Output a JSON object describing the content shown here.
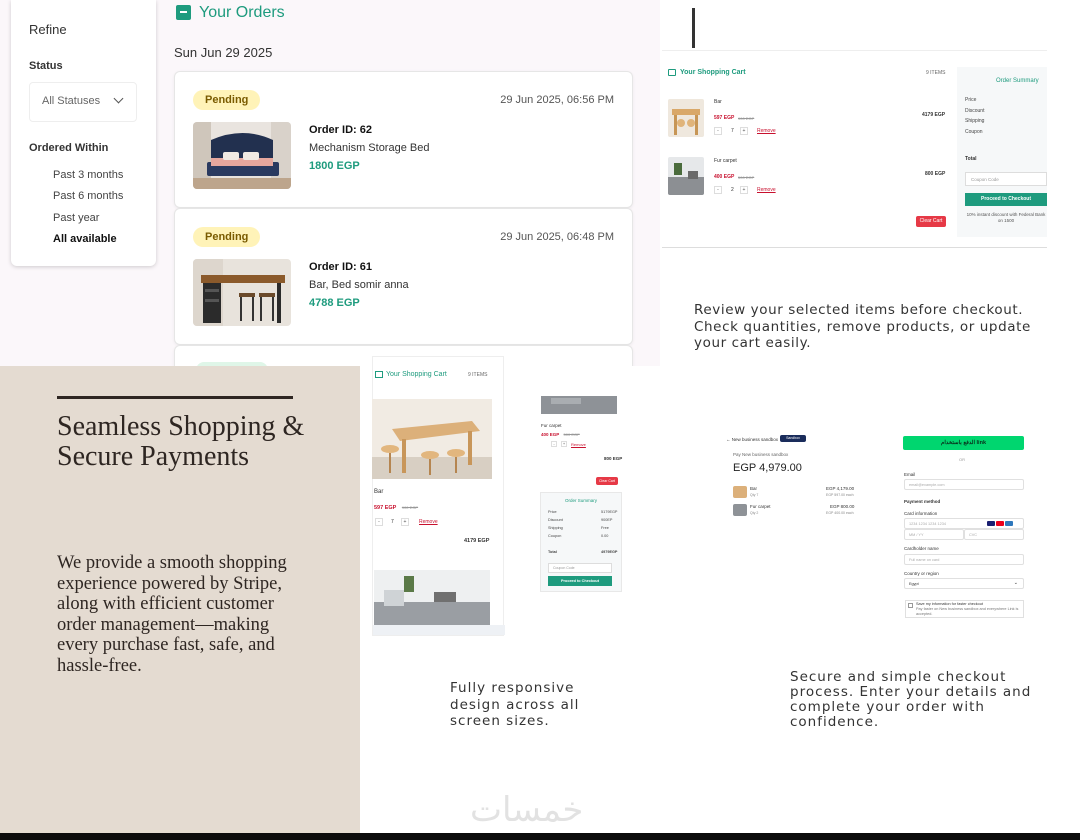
{
  "orders": {
    "heading": "Your Orders",
    "date": "Sun Jun 29 2025",
    "refine": {
      "title": "Refine",
      "status_label": "Status",
      "status_value": "All Statuses",
      "ordered_within_label": "Ordered Within",
      "ranges": [
        "Past 3 months",
        "Past 6 months",
        "Past year",
        "All available"
      ],
      "selected_range": "All available"
    },
    "cards": [
      {
        "status": "Pending",
        "datetime": "29 Jun 2025, 06:56 PM",
        "order_id": "Order ID: 62",
        "product": "Mechanism Storage Bed",
        "price": "1800 EGP"
      },
      {
        "status": "Pending",
        "datetime": "29 Jun 2025, 06:48 PM",
        "order_id": "Order ID: 61",
        "product": "Bar, Bed somir anna",
        "price": "4788 EGP"
      }
    ]
  },
  "cart_desktop": {
    "title": "Your Shopping Cart",
    "count": "9 ITEMS",
    "items": [
      {
        "name": "Bar",
        "price": "597 EGP",
        "old_price": "900 EGP",
        "qty": "7",
        "remove": "Remove",
        "total": "4179 EGP"
      },
      {
        "name": "Fur carpet",
        "price": "400 EGP",
        "old_price": "500 EGP",
        "qty": "2",
        "remove": "Remove",
        "total": "800 EGP"
      }
    ],
    "clear_cart": "Clear Cart",
    "summary": {
      "heading": "Order Summary",
      "labels": [
        "Price",
        "Discount",
        "Shipping",
        "Coupon"
      ],
      "total_label": "Total",
      "coupon_placeholder": "Coupon Code",
      "checkout_button": "Proceed to Checkout",
      "note": "10% instant discount with Federal Bank on 1500"
    },
    "caption": "Review your selected items before checkout. Check quantities, remove products, or update your cart easily."
  },
  "promo": {
    "title": "Seamless Shopping & Secure Payments",
    "body": "We provide a smooth shopping experience powered by Stripe, along with efficient customer order management—making every purchase fast, safe, and hassle-free."
  },
  "cart_mobile": {
    "title": "Your Shopping Cart",
    "count": "9 ITEMS",
    "item_name": "Bar",
    "item_price": "597 EGP",
    "item_old_price": "900 EGP",
    "item_qty": "7",
    "item_remove": "Remove",
    "item_total": "4179 EGP",
    "second_name": "Fur carpet",
    "second_price": "400 EGP",
    "second_old_price": "500 EGP",
    "second_remove": "Remove",
    "second_total": "800 EGP",
    "clear_cart": "Clear Cart",
    "summary_heading": "Order Summary",
    "summary_rows": [
      {
        "label": "Price",
        "value": "5179EGP"
      },
      {
        "label": "Discount",
        "value": "900EP"
      },
      {
        "label": "Shipping",
        "value": "Free"
      },
      {
        "label": "Coupon",
        "value": "0.00"
      }
    ],
    "total_label": "Total",
    "total_value": "4979EGP",
    "coupon_placeholder": "Coupon Code",
    "checkout_button": "Proceed to Checkout",
    "caption": "Fully responsive design across all screen sizes."
  },
  "checkout": {
    "business": "New business sandbox",
    "sandbox_badge": "Sandbox",
    "pay_to": "Pay New business sandbox",
    "amount": "EGP 4,979.00",
    "items": [
      {
        "name": "Bar",
        "qty": "Qty 7",
        "price": "EGP 4,179.00",
        "unit": "EGP 597.00 each"
      },
      {
        "name": "Fur carpet",
        "qty": "Qty 2",
        "price": "EGP 800.00",
        "unit": "EGP 400.00 each"
      }
    ],
    "link_button": "الدفع باستخدام link",
    "or": "OR",
    "email_label": "Email",
    "email_placeholder": "email@example.com",
    "payment_method": "Payment method",
    "card_info": "Card information",
    "card_number": "1234 1234 1234 1234",
    "card_expiry": "MM / YY",
    "card_cvc": "CVC",
    "cardholder_label": "Cardholder name",
    "cardholder_placeholder": "Full name on card",
    "country_label": "Country or region",
    "country_value": "Egypt",
    "save_info": "Save my information for faster checkout",
    "save_info_sub": "Pay faster on New business sandbox and everywhere Link is accepted.",
    "caption": "Secure and simple checkout process. Enter your details and complete your order with confidence."
  },
  "watermark": "خمسات",
  "colors": {
    "accent": "#1e9b7e",
    "promo_bg": "#e4dbd1",
    "pending_bg": "#fff3b8",
    "danger": "#e63946",
    "link_green": "#00d66f"
  }
}
